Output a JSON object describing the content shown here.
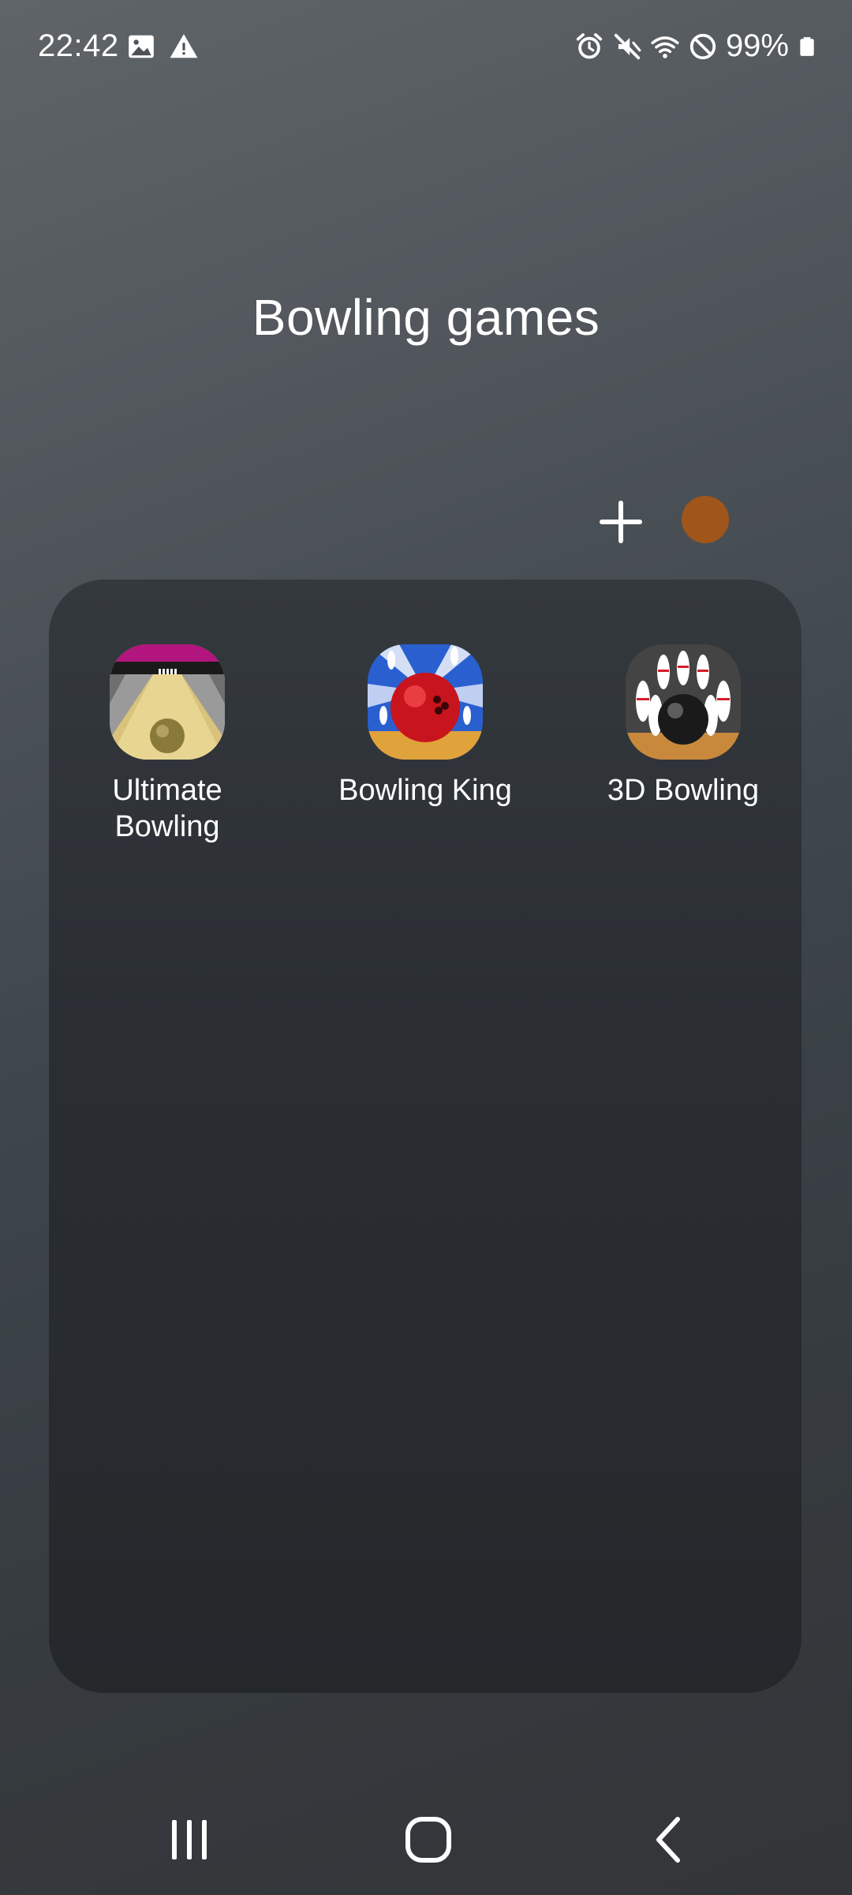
{
  "status_bar": {
    "time": "22:42",
    "battery_text": "99%",
    "left_icons": [
      "image-icon",
      "warning-icon"
    ],
    "right_icons": [
      "alarm-icon",
      "mute-icon",
      "wifi-icon",
      "do-not-disturb-icon",
      "battery-icon"
    ]
  },
  "folder": {
    "title": "Bowling games",
    "color": "#a0561a",
    "apps": [
      {
        "label": "Ultimate\nBowling",
        "icon": "ultimate-bowling-icon"
      },
      {
        "label": "Bowling King",
        "icon": "bowling-king-icon"
      },
      {
        "label": "3D Bowling",
        "icon": "3d-bowling-icon"
      }
    ]
  },
  "nav_bar": {
    "buttons": [
      "recent-apps-icon",
      "home-icon",
      "back-icon"
    ]
  }
}
